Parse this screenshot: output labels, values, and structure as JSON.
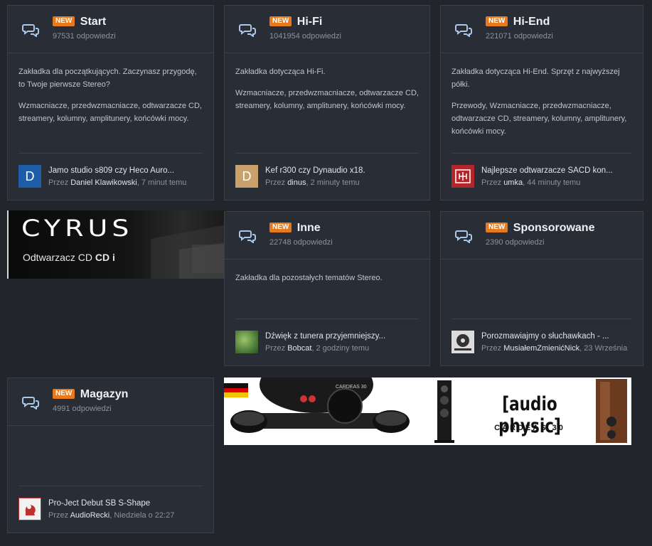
{
  "categories": [
    {
      "badge": "NEW",
      "title": "Start",
      "count": "97531 odpowiedzi",
      "desc": [
        "Zakładka dla początkujących. Zaczynasz przygodę, to Twoje pierwsze Stereo?",
        "Wzmacniacze, przedwzmacniacze, odtwarzacze CD, streamery, kolumny, amplitunery, końcówki mocy."
      ],
      "last_post": {
        "title": "Jamo studio s809 czy Heco Auro...",
        "by": "Przez",
        "author": "Daniel Klawikowski",
        "time": ", 7 minut temu",
        "avatar_letter": "D",
        "avatar_color": "#1e5ea8"
      }
    },
    {
      "badge": "NEW",
      "title": "Hi-Fi",
      "count": "1041954 odpowiedzi",
      "desc": [
        "Zakładka dotycząca Hi-Fi.",
        "Wzmacniacze, przedwzmacniacze, odtwarzacze CD, streamery, kolumny, amplitunery, końcówki mocy."
      ],
      "last_post": {
        "title": "Kef r300 czy Dynaudio x18.",
        "by": "Przez",
        "author": "dinus",
        "time": ", 2 minuty temu",
        "avatar_letter": "D",
        "avatar_color": "#c9a26b"
      }
    },
    {
      "badge": "NEW",
      "title": "Hi-End",
      "count": "221071 odpowiedzi",
      "desc": [
        "Zakładka dotycząca Hi-End. Sprzęt z najwyższej półki.",
        "Przewody, Wzmacniacze, przedwzmacniacze, odtwarzacze CD, streamery, kolumny, amplitunery, końcówki mocy."
      ],
      "last_post": {
        "title": "Najlepsze odtwarzacze SACD kon...",
        "by": "Przez",
        "author": "umka",
        "time": ", 44 minuty temu",
        "avatar_letter": "",
        "avatar_color": "#b3262a"
      }
    },
    {
      "badge": "NEW",
      "title": "Inne",
      "count": "22748 odpowiedzi",
      "desc": [
        "Zakładka dla pozostałych tematów Stereo."
      ],
      "last_post": {
        "title": "Dźwięk z tunera przyjemniejszy...",
        "by": "Przez",
        "author": "Bobcat",
        "time": ", 2 godziny temu",
        "avatar_letter": "",
        "avatar_color": "#4f7f3a"
      }
    },
    {
      "badge": "NEW",
      "title": "Sponsorowane",
      "count": "2390 odpowiedzi",
      "desc": [],
      "last_post": {
        "title": "Porozmawiajmy o słuchawkach - ...",
        "by": "Przez",
        "author": "MusiałemZmienićNick",
        "time": ", 23 Września",
        "avatar_letter": "",
        "avatar_color": "#dcdcdc"
      }
    },
    {
      "badge": "NEW",
      "title": "Magazyn",
      "count": "4991 odpowiedzi",
      "desc": [],
      "last_post": {
        "title": "Pro-Ject Debut SB S-Shape",
        "by": "Przez",
        "author": "AudioRecki",
        "time": ", Niedziela o 22:27",
        "avatar_letter": "",
        "avatar_color": "#f2f2f2"
      }
    }
  ],
  "banners": {
    "cyrus_logo": "CYRUS",
    "cyrus_caption": "Odtwarzacz CD",
    "cyrus_model": "CD i",
    "audio_physic_logo": "[audio physic]",
    "audio_physic_model": "CARDEAS 30",
    "turntable_label": "CARDEAS 30"
  },
  "colors": {
    "background": "#22252c",
    "card": "#292d35",
    "border": "#3a3f48",
    "badge": "#e87a1e"
  }
}
